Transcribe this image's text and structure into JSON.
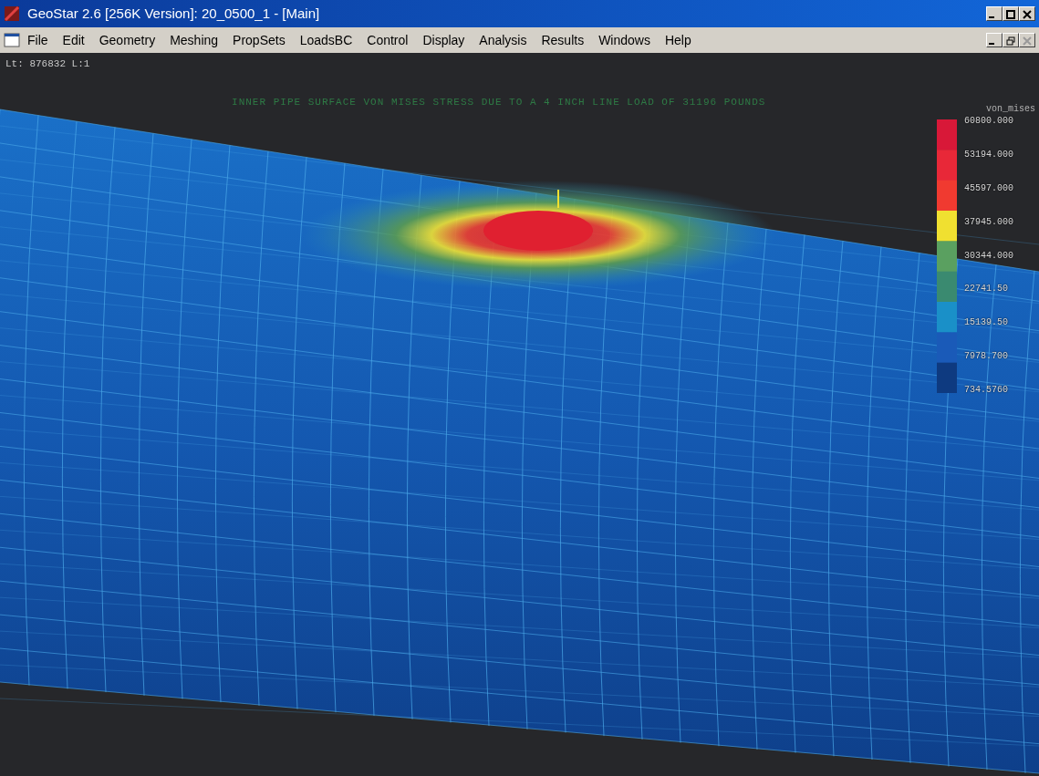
{
  "window": {
    "title": "GeoStar 2.6 [256K Version]: 20_0500_1 - [Main]"
  },
  "menu": [
    "File",
    "Edit",
    "Geometry",
    "Meshing",
    "PropSets",
    "LoadsBC",
    "Control",
    "Display",
    "Analysis",
    "Results",
    "Windows",
    "Help"
  ],
  "status_line": "Lt: 876832 L:1",
  "plot_title": "INNER PIPE SURFACE VON MISES STRESS DUE TO A 4 INCH LINE LOAD OF 31196 POUNDS",
  "legend": {
    "title": "von_mises",
    "labels": [
      "60800.000",
      "53194.000",
      "45597.000",
      "37945.000",
      "30344.000",
      "22741.50",
      "15139.50",
      "7978.700",
      "734.5760"
    ]
  }
}
